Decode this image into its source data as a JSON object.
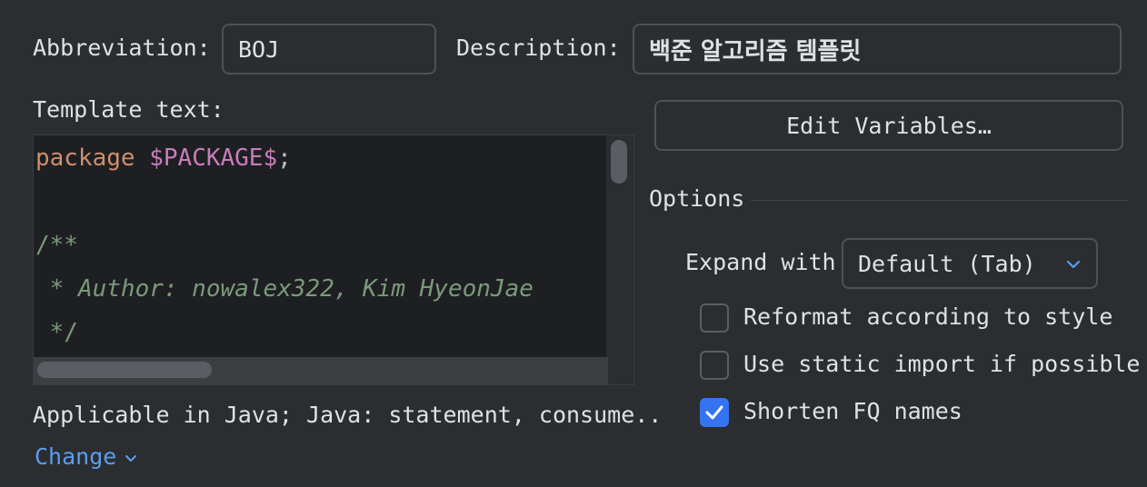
{
  "abbreviation": {
    "label": "Abbreviation:",
    "value": "BOJ"
  },
  "description": {
    "label": "Description:",
    "value": "백준 알고리즘 템플릿"
  },
  "template_text": {
    "label": "Template text:",
    "lines": {
      "l1_keyword": "package ",
      "l1_var": "$PACKAGE$",
      "l1_end": ";",
      "l3": "/**",
      "l4": " * Author: nowalex322, Kim HyeonJae",
      "l5": " */"
    }
  },
  "edit_variables_button": "Edit Variables…",
  "options": {
    "title": "Options",
    "expand_with_label": "Expand with",
    "expand_with_value": "Default (Tab)",
    "checkboxes": [
      {
        "label": "Reformat according to style",
        "checked": false
      },
      {
        "label": "Use static import if possible",
        "checked": false
      },
      {
        "label": "Shorten FQ names",
        "checked": true
      }
    ]
  },
  "applicable": {
    "text": "Applicable in Java; Java: statement, consume..",
    "change_link": "Change"
  },
  "colors": {
    "background": "#2b2d30",
    "editor_background": "#1e1f22",
    "keyword": "#cf8e6d",
    "variable": "#c77dbb",
    "comment": "#7a9a7a",
    "accent": "#3574f0",
    "link": "#5c9ded"
  }
}
